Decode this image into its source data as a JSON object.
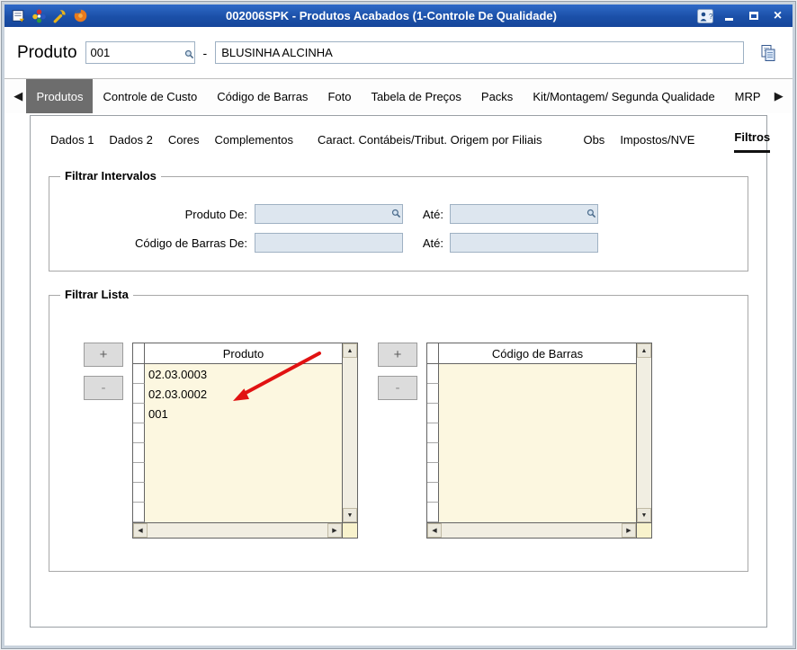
{
  "colors": {
    "titlebar_blue": "#1b50a8",
    "selected_tab_gray": "#6d6d6d",
    "list_background_cream": "#fcf7e0",
    "disabled_field_blue": "#dde6ef",
    "annotation_red": "#e11212"
  },
  "window": {
    "title": "002006SPK - Produtos Acabados (1-Controle De Qualidade)"
  },
  "icons": {
    "nav_left": "◀",
    "nav_right": "▶",
    "scroll_up": "▲",
    "scroll_down": "▼",
    "scroll_left": "◀",
    "scroll_right": "▶",
    "close": "×"
  },
  "header": {
    "product_label": "Produto",
    "product_code": "001",
    "separator": "-",
    "product_name": "BLUSINHA ALCINHA"
  },
  "main_tabs": {
    "selected": "Produtos",
    "items": [
      "Produtos",
      "Controle de Custo",
      "Código de Barras",
      "Foto",
      "Tabela de Preços",
      "Packs",
      "Kit/Montagem/ Segunda Qualidade",
      "MRP"
    ]
  },
  "sub_tabs": {
    "selected": "Filtros",
    "items": [
      "Dados 1",
      "Dados 2",
      "Cores",
      "Complementos",
      "Caract. Contábeis/Tribut. Origem por Filiais",
      "Obs",
      "Impostos/NVE",
      "Filtros"
    ]
  },
  "filter_intervals": {
    "title": "Filtrar Intervalos",
    "product_from_label": "Produto De:",
    "product_to_label": "Até:",
    "barcode_from_label": "Código de Barras De:",
    "barcode_to_label": "Até:",
    "values": {
      "product_from": "",
      "product_to": "",
      "barcode_from": "",
      "barcode_to": ""
    }
  },
  "filter_list": {
    "title": "Filtrar Lista",
    "add_label": "+",
    "remove_label": "-",
    "product_list": {
      "header": "Produto",
      "items": [
        "02.03.0003",
        "02.03.0002",
        "001"
      ]
    },
    "barcode_list": {
      "header": "Código de Barras",
      "items": []
    }
  }
}
